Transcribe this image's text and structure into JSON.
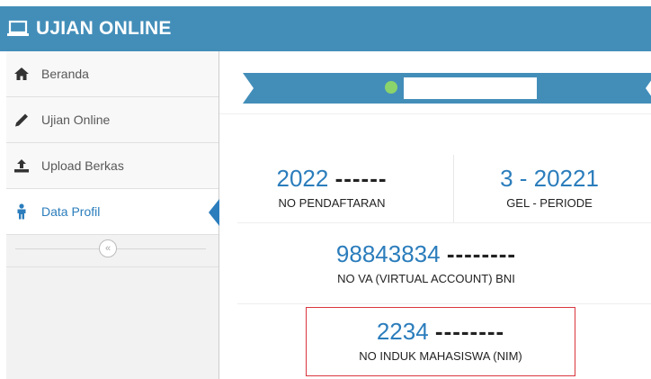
{
  "header": {
    "app_title": "UJIAN ONLINE",
    "brand_color": "#438eb9"
  },
  "sidebar": {
    "items": [
      {
        "label": "Beranda",
        "icon": "home-icon",
        "active": false
      },
      {
        "label": "Ujian Online",
        "icon": "pencil-icon",
        "active": false
      },
      {
        "label": "Upload Berkas",
        "icon": "upload-icon",
        "active": false
      },
      {
        "label": "Data Profil",
        "icon": "person-icon",
        "active": true
      }
    ],
    "collapse_icon": "double-chevron-left-icon",
    "collapse_glyph": "«"
  },
  "profile": {
    "status_dot_color": "#8bd36b",
    "registration": {
      "value": "2022",
      "masked": "------",
      "label": "NO PENDAFTARAN"
    },
    "period": {
      "value": "3 - 20221",
      "label": "GEL - PERIODE"
    },
    "virtual_account": {
      "value": "98843834",
      "masked": "--------",
      "label": "NO VA (VIRTUAL ACCOUNT) BNI"
    },
    "nim": {
      "value": "2234",
      "masked": "--------",
      "label": "NO INDUK MAHASISWA (NIM)"
    }
  }
}
